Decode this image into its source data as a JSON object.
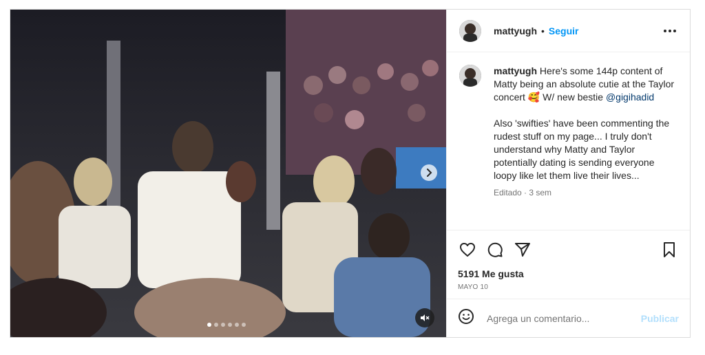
{
  "post": {
    "username": "mattyugh",
    "separator": "•",
    "follow_label": "Seguir",
    "caption": {
      "username": "mattyugh",
      "text_part1": " Here's some 144p content of Matty being an absolute cutie at the Taylor concert ",
      "emoji": "🥰",
      "text_part2": " W/ new bestie ",
      "mention": "@gigihadid",
      "paragraph2": "Also 'swifties' have been commenting the rudest stuff on my page... I truly don't understand why Matty and Taylor potentially dating is sending everyone loopy like let them live their lives...",
      "edited": "Editado · 3 sem"
    },
    "likes": "5191 Me gusta",
    "date": "MAYO 10",
    "comment_placeholder": "Agrega un comentario...",
    "publish_label": "Publicar"
  },
  "icons": {
    "more": "more-options-icon",
    "like": "heart-icon",
    "comment": "comment-icon",
    "share": "send-icon",
    "save": "bookmark-icon",
    "emoji": "emoji-icon",
    "next": "chevron-right-icon",
    "mute": "speaker-muted-icon"
  },
  "carousel": {
    "slides": 6,
    "current": 1
  },
  "colors": {
    "link": "#0095f6",
    "mention": "#00376b",
    "publish_disabled": "#b2dffc",
    "muted_text": "#737373"
  }
}
